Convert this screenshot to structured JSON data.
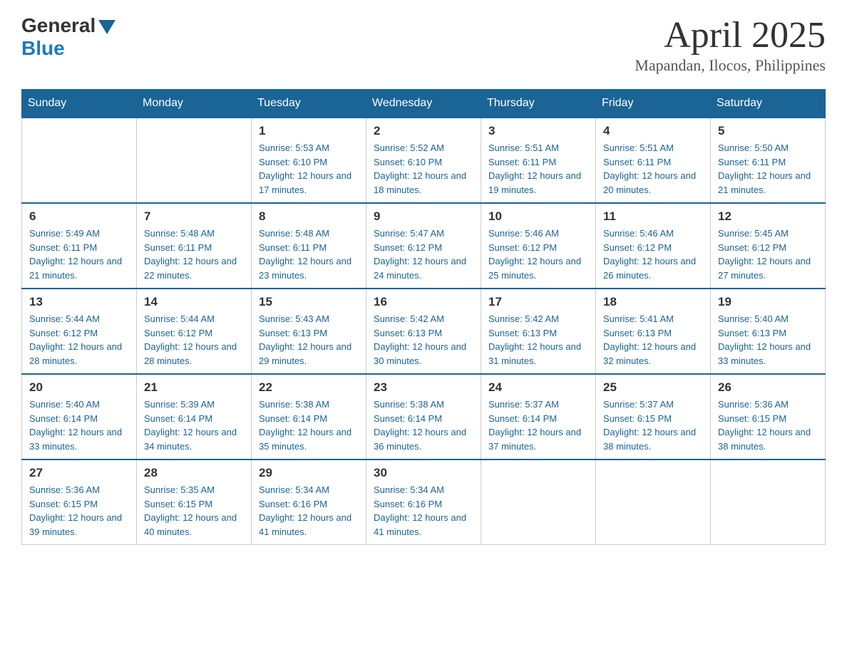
{
  "logo": {
    "general": "General",
    "blue": "Blue"
  },
  "title": "April 2025",
  "subtitle": "Mapandan, Ilocos, Philippines",
  "days": {
    "headers": [
      "Sunday",
      "Monday",
      "Tuesday",
      "Wednesday",
      "Thursday",
      "Friday",
      "Saturday"
    ]
  },
  "weeks": [
    {
      "days": [
        {
          "num": "",
          "sunrise": "",
          "sunset": "",
          "daylight": ""
        },
        {
          "num": "",
          "sunrise": "",
          "sunset": "",
          "daylight": ""
        },
        {
          "num": "1",
          "sunrise": "Sunrise: 5:53 AM",
          "sunset": "Sunset: 6:10 PM",
          "daylight": "Daylight: 12 hours and 17 minutes."
        },
        {
          "num": "2",
          "sunrise": "Sunrise: 5:52 AM",
          "sunset": "Sunset: 6:10 PM",
          "daylight": "Daylight: 12 hours and 18 minutes."
        },
        {
          "num": "3",
          "sunrise": "Sunrise: 5:51 AM",
          "sunset": "Sunset: 6:11 PM",
          "daylight": "Daylight: 12 hours and 19 minutes."
        },
        {
          "num": "4",
          "sunrise": "Sunrise: 5:51 AM",
          "sunset": "Sunset: 6:11 PM",
          "daylight": "Daylight: 12 hours and 20 minutes."
        },
        {
          "num": "5",
          "sunrise": "Sunrise: 5:50 AM",
          "sunset": "Sunset: 6:11 PM",
          "daylight": "Daylight: 12 hours and 21 minutes."
        }
      ]
    },
    {
      "days": [
        {
          "num": "6",
          "sunrise": "Sunrise: 5:49 AM",
          "sunset": "Sunset: 6:11 PM",
          "daylight": "Daylight: 12 hours and 21 minutes."
        },
        {
          "num": "7",
          "sunrise": "Sunrise: 5:48 AM",
          "sunset": "Sunset: 6:11 PM",
          "daylight": "Daylight: 12 hours and 22 minutes."
        },
        {
          "num": "8",
          "sunrise": "Sunrise: 5:48 AM",
          "sunset": "Sunset: 6:11 PM",
          "daylight": "Daylight: 12 hours and 23 minutes."
        },
        {
          "num": "9",
          "sunrise": "Sunrise: 5:47 AM",
          "sunset": "Sunset: 6:12 PM",
          "daylight": "Daylight: 12 hours and 24 minutes."
        },
        {
          "num": "10",
          "sunrise": "Sunrise: 5:46 AM",
          "sunset": "Sunset: 6:12 PM",
          "daylight": "Daylight: 12 hours and 25 minutes."
        },
        {
          "num": "11",
          "sunrise": "Sunrise: 5:46 AM",
          "sunset": "Sunset: 6:12 PM",
          "daylight": "Daylight: 12 hours and 26 minutes."
        },
        {
          "num": "12",
          "sunrise": "Sunrise: 5:45 AM",
          "sunset": "Sunset: 6:12 PM",
          "daylight": "Daylight: 12 hours and 27 minutes."
        }
      ]
    },
    {
      "days": [
        {
          "num": "13",
          "sunrise": "Sunrise: 5:44 AM",
          "sunset": "Sunset: 6:12 PM",
          "daylight": "Daylight: 12 hours and 28 minutes."
        },
        {
          "num": "14",
          "sunrise": "Sunrise: 5:44 AM",
          "sunset": "Sunset: 6:12 PM",
          "daylight": "Daylight: 12 hours and 28 minutes."
        },
        {
          "num": "15",
          "sunrise": "Sunrise: 5:43 AM",
          "sunset": "Sunset: 6:13 PM",
          "daylight": "Daylight: 12 hours and 29 minutes."
        },
        {
          "num": "16",
          "sunrise": "Sunrise: 5:42 AM",
          "sunset": "Sunset: 6:13 PM",
          "daylight": "Daylight: 12 hours and 30 minutes."
        },
        {
          "num": "17",
          "sunrise": "Sunrise: 5:42 AM",
          "sunset": "Sunset: 6:13 PM",
          "daylight": "Daylight: 12 hours and 31 minutes."
        },
        {
          "num": "18",
          "sunrise": "Sunrise: 5:41 AM",
          "sunset": "Sunset: 6:13 PM",
          "daylight": "Daylight: 12 hours and 32 minutes."
        },
        {
          "num": "19",
          "sunrise": "Sunrise: 5:40 AM",
          "sunset": "Sunset: 6:13 PM",
          "daylight": "Daylight: 12 hours and 33 minutes."
        }
      ]
    },
    {
      "days": [
        {
          "num": "20",
          "sunrise": "Sunrise: 5:40 AM",
          "sunset": "Sunset: 6:14 PM",
          "daylight": "Daylight: 12 hours and 33 minutes."
        },
        {
          "num": "21",
          "sunrise": "Sunrise: 5:39 AM",
          "sunset": "Sunset: 6:14 PM",
          "daylight": "Daylight: 12 hours and 34 minutes."
        },
        {
          "num": "22",
          "sunrise": "Sunrise: 5:38 AM",
          "sunset": "Sunset: 6:14 PM",
          "daylight": "Daylight: 12 hours and 35 minutes."
        },
        {
          "num": "23",
          "sunrise": "Sunrise: 5:38 AM",
          "sunset": "Sunset: 6:14 PM",
          "daylight": "Daylight: 12 hours and 36 minutes."
        },
        {
          "num": "24",
          "sunrise": "Sunrise: 5:37 AM",
          "sunset": "Sunset: 6:14 PM",
          "daylight": "Daylight: 12 hours and 37 minutes."
        },
        {
          "num": "25",
          "sunrise": "Sunrise: 5:37 AM",
          "sunset": "Sunset: 6:15 PM",
          "daylight": "Daylight: 12 hours and 38 minutes."
        },
        {
          "num": "26",
          "sunrise": "Sunrise: 5:36 AM",
          "sunset": "Sunset: 6:15 PM",
          "daylight": "Daylight: 12 hours and 38 minutes."
        }
      ]
    },
    {
      "days": [
        {
          "num": "27",
          "sunrise": "Sunrise: 5:36 AM",
          "sunset": "Sunset: 6:15 PM",
          "daylight": "Daylight: 12 hours and 39 minutes."
        },
        {
          "num": "28",
          "sunrise": "Sunrise: 5:35 AM",
          "sunset": "Sunset: 6:15 PM",
          "daylight": "Daylight: 12 hours and 40 minutes."
        },
        {
          "num": "29",
          "sunrise": "Sunrise: 5:34 AM",
          "sunset": "Sunset: 6:16 PM",
          "daylight": "Daylight: 12 hours and 41 minutes."
        },
        {
          "num": "30",
          "sunrise": "Sunrise: 5:34 AM",
          "sunset": "Sunset: 6:16 PM",
          "daylight": "Daylight: 12 hours and 41 minutes."
        },
        {
          "num": "",
          "sunrise": "",
          "sunset": "",
          "daylight": ""
        },
        {
          "num": "",
          "sunrise": "",
          "sunset": "",
          "daylight": ""
        },
        {
          "num": "",
          "sunrise": "",
          "sunset": "",
          "daylight": ""
        }
      ]
    }
  ]
}
